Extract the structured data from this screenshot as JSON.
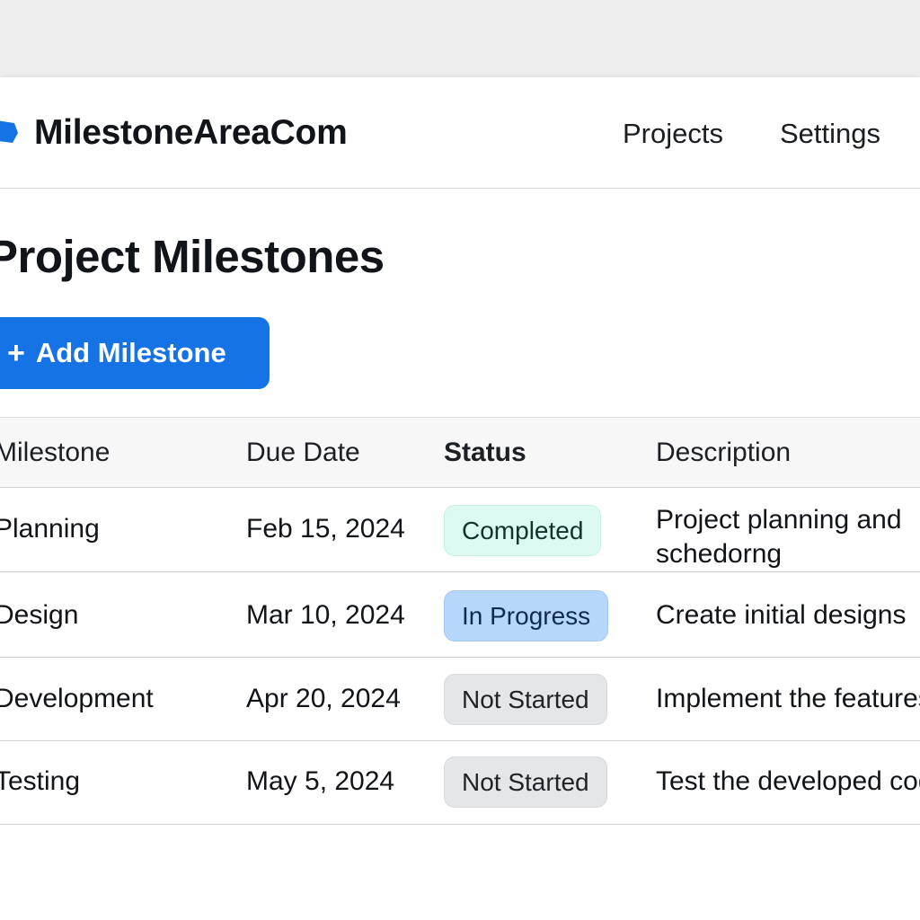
{
  "app": {
    "title": "MilestoneAreaCom",
    "brand_color": "#1673e6"
  },
  "nav": {
    "items": [
      {
        "label": "Projects"
      },
      {
        "label": "Settings"
      }
    ]
  },
  "page": {
    "title": "Project Milestones"
  },
  "toolbar": {
    "add_icon": "+",
    "add_label": "Add Milestone"
  },
  "table": {
    "columns": [
      "Milestone",
      "Due Date",
      "Status",
      "Description"
    ],
    "rows": [
      {
        "milestone": "Planning",
        "due_date": "Feb 15, 2024",
        "status": "Completed",
        "status_color": "#dcfaf1",
        "description_line1": "Project planning and",
        "description_line2": "schedorng"
      },
      {
        "milestone": "Design",
        "due_date": "Mar 10, 2024",
        "status": "In Progress",
        "status_color": "#b7d6fb",
        "description": "Create initial designs"
      },
      {
        "milestone": "Development",
        "due_date": "Apr 20, 2024",
        "status": "Not Started",
        "status_color": "#e5e6e8",
        "description": "Implement the features"
      },
      {
        "milestone": "Testing",
        "due_date": "May 5, 2024",
        "status": "Not Started",
        "status_color": "#e5e6e8",
        "description": "Test the developed code"
      }
    ]
  },
  "icons": {
    "logo": "blue-star-logo-icon"
  }
}
